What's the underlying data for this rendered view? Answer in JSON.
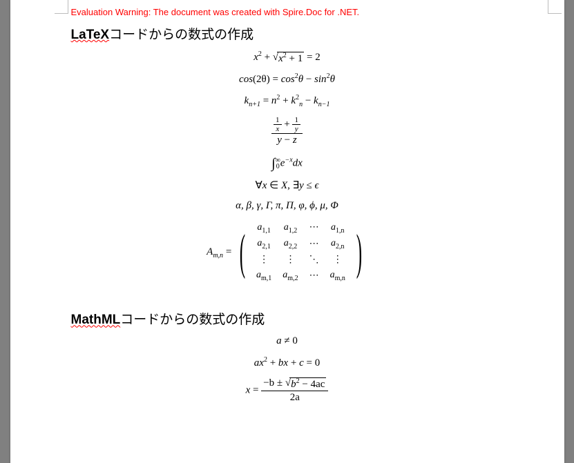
{
  "warning": "Evaluation Warning: The document was created with Spire.Doc for .NET.",
  "headings": {
    "latex_latin": "LaTeX",
    "latex_jp": "コードからの数式の作成",
    "mathml_latin": "MathML",
    "mathml_jp": "コードからの数式の作成"
  },
  "greek_list": "α, β, γ, Γ, π, Π, φ, ϕ, μ, Φ",
  "chart_data": {
    "type": "table",
    "title": "Mathematical equations rendered from LaTeX and MathML",
    "latex_equations": [
      "x^2 + \\sqrt{x^2 + 1} = 2",
      "\\cos(2\\theta) = \\cos^2\\theta - \\sin^2\\theta",
      "k_{n+1} = n^2 + k_n^2 - k_{n-1}",
      "\\frac{\\frac{1}{x} + \\frac{1}{y}}{y - z}",
      "\\int_0^\\infty e^{-x}\\,dx",
      "\\forall x \\in X,\\ \\exists y \\le \\epsilon",
      "\\alpha,\\beta,\\gamma,\\Gamma,\\pi,\\Pi,\\varphi,\\phi,\\mu,\\Phi",
      "A_{m,n} = \\begin{pmatrix} a_{1,1} & a_{1,2} & \\cdots & a_{1,n} \\\\ a_{2,1} & a_{2,2} & \\cdots & a_{2,n} \\\\ \\vdots & \\vdots & \\ddots & \\vdots \\\\ a_{m,1} & a_{m,2} & \\cdots & a_{m,n} \\end{pmatrix}"
    ],
    "mathml_equations": [
      "a \\ne 0",
      "a x^2 + b x + c = 0",
      "x = \\frac{-b \\pm \\sqrt{b^2 - 4ac}}{2a}"
    ]
  },
  "matrix": {
    "lhs_var": "A",
    "lhs_sub": "m,n",
    "rows": [
      [
        {
          "v": "a",
          "s": "1,1"
        },
        {
          "v": "a",
          "s": "1,2"
        },
        {
          "v": "⋯",
          "s": ""
        },
        {
          "v": "a",
          "s": "1,n"
        }
      ],
      [
        {
          "v": "a",
          "s": "2,1"
        },
        {
          "v": "a",
          "s": "2,2"
        },
        {
          "v": "⋯",
          "s": ""
        },
        {
          "v": "a",
          "s": "2,n"
        }
      ],
      [
        {
          "v": "⋮",
          "s": ""
        },
        {
          "v": "⋮",
          "s": ""
        },
        {
          "v": "⋱",
          "s": ""
        },
        {
          "v": "⋮",
          "s": ""
        }
      ],
      [
        {
          "v": "a",
          "s": "m,1"
        },
        {
          "v": "a",
          "s": "m,2"
        },
        {
          "v": "⋯",
          "s": ""
        },
        {
          "v": "a",
          "s": "m,n"
        }
      ]
    ]
  },
  "sym": {
    "x": "x",
    "y": "y",
    "z": "z",
    "n": "n",
    "k": "k",
    "a": "a",
    "b": "b",
    "c": "c",
    "plus": " + ",
    "minus": " − ",
    "eq": " = ",
    "neq": " ≠ ",
    "pm": " ± ",
    "two": "2",
    "one": "1",
    "zero": "0",
    "four": "4",
    "cos": "cos",
    "sin": "sin",
    "theta": "θ",
    "twotheta": "(2θ)",
    "np1": "n+1",
    "nm1": "n−1",
    "int": "∫",
    "inf": "∞",
    "e": "e",
    "mx": "−x",
    "dx": "dx",
    "forall": "∀",
    "in": " ∈ ",
    "X": "X",
    "comma": ", ",
    "exists": "∃",
    "le": " ≤ ",
    "eps": "ϵ",
    "mb": "−b",
    "twoa": "2a",
    "b2": "b",
    "m4ac": " − 4ac",
    "radical": "√"
  }
}
